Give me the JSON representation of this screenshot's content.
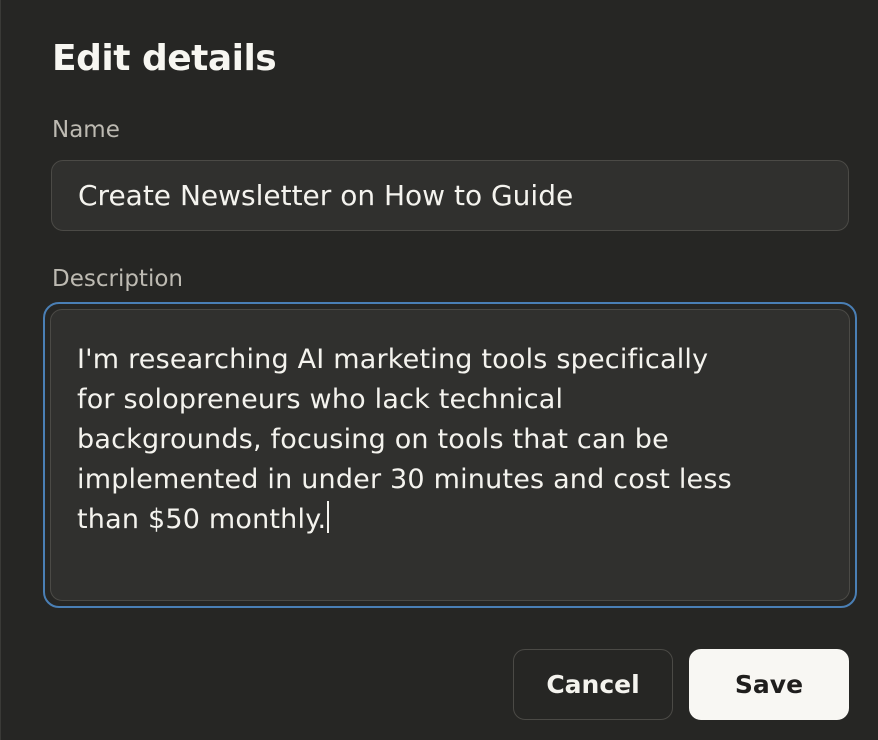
{
  "dialog": {
    "title": "Edit details",
    "name_label": "Name",
    "name_value": "Create Newsletter on How to Guide",
    "description_label": "Description",
    "description_lines": [
      "I'm researching AI marketing tools specifically",
      "for solopreneurs who lack technical",
      "backgrounds, focusing on tools that can be",
      "implemented in under 30 minutes and cost less",
      "than $50 monthly."
    ],
    "cancel_label": "Cancel",
    "save_label": "Save"
  },
  "colors": {
    "background": "#262624",
    "field_background": "#30302e",
    "focus_ring": "#4a7fb5",
    "primary_button": "#f8f7f3"
  }
}
